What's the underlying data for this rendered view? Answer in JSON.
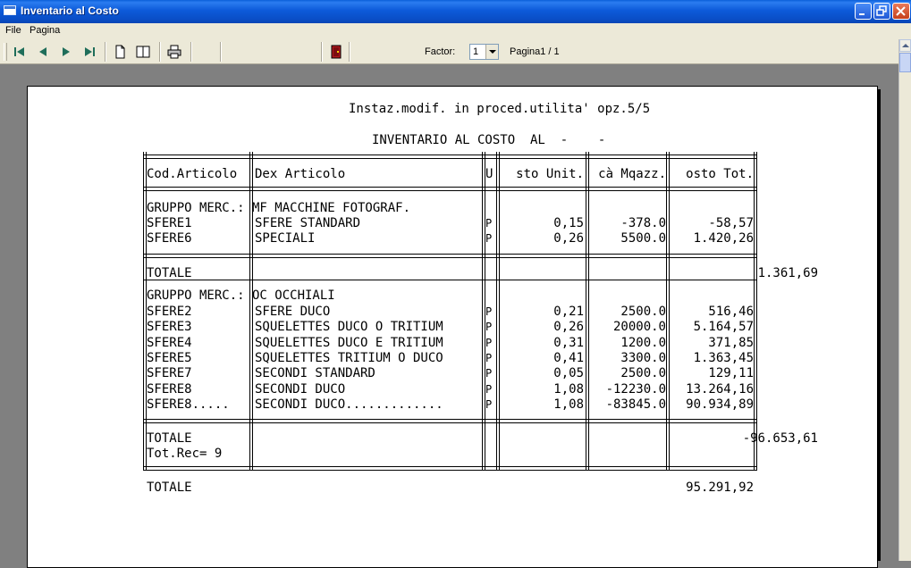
{
  "window": {
    "title": "Inventario al Costo",
    "minimize": "_",
    "maximize": "□",
    "close": "×"
  },
  "menu": [
    "File",
    "Pagina"
  ],
  "toolbar": {
    "factor_label": "Factor:",
    "factor_value": "1",
    "page_label": "Pagina1 / 1"
  },
  "report": {
    "line1": "Instaz.modif. in proced.utilita' opz.5/5",
    "line2": "INVENTARIO AL COSTO  AL  -    -",
    "columns": [
      "Cod.Articolo",
      "Dex Articolo",
      "U",
      "sto Unit.",
      "cà Mqazz.",
      "osto Tot."
    ],
    "groups": [
      {
        "header": "GRUPPO MERC.: MF MACCHINE FOTOGRAF.",
        "rows": [
          {
            "code": "SFERE1",
            "desc": "SFERE STANDARD",
            "u": "P",
            "unit": "0,15",
            "qty": "-378.0",
            "tot": "-58,57"
          },
          {
            "code": "SFERE6",
            "desc": "SPECIALI",
            "u": "P",
            "unit": "0,26",
            "qty": "5500.0",
            "tot": "1.420,26"
          }
        ],
        "total_label": "TOTALE",
        "total_value": "1.361,69"
      },
      {
        "header": "GRUPPO MERC.: OC OCCHIALI",
        "rows": [
          {
            "code": "SFERE2",
            "desc": "SFERE DUCO",
            "u": "P",
            "unit": "0,21",
            "qty": "2500.0",
            "tot": "516,46"
          },
          {
            "code": "SFERE3",
            "desc": "SQUELETTES DUCO O TRITIUM",
            "u": "P",
            "unit": "0,26",
            "qty": "20000.0",
            "tot": "5.164,57"
          },
          {
            "code": "SFERE4",
            "desc": "SQUELETTES DUCO E TRITIUM",
            "u": "P",
            "unit": "0,31",
            "qty": "1200.0",
            "tot": "371,85"
          },
          {
            "code": "SFERE5",
            "desc": "SQUELETTES TRITIUM O DUCO",
            "u": "P",
            "unit": "0,41",
            "qty": "3300.0",
            "tot": "1.363,45"
          },
          {
            "code": "SFERE7",
            "desc": "SECONDI STANDARD",
            "u": "P",
            "unit": "0,05",
            "qty": "2500.0",
            "tot": "129,11"
          },
          {
            "code": "SFERE8",
            "desc": "SECONDI DUCO",
            "u": "P",
            "unit": "1,08",
            "qty": "-12230.0",
            "tot": "13.264,16"
          },
          {
            "code": "SFERE8.....",
            "desc": "SECONDI DUCO.............",
            "u": "P",
            "unit": "1,08",
            "qty": "-83845.0",
            "tot": "90.934,89"
          }
        ],
        "total_label": "TOTALE",
        "total_value": "-96.653,61",
        "rec_label": "Tot.Rec= 9"
      }
    ],
    "grand_total_label": "TOTALE",
    "grand_total_value": "95.291,92"
  }
}
